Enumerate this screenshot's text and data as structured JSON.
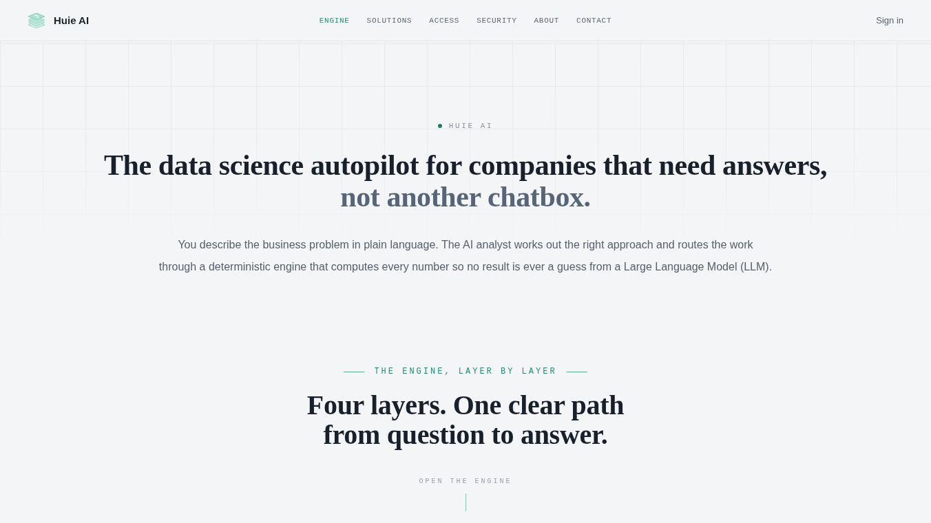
{
  "header": {
    "brand": "Huie AI",
    "nav": [
      {
        "label": "ENGINE",
        "selected": true
      },
      {
        "label": "SOLUTIONS",
        "selected": false
      },
      {
        "label": "ACCESS",
        "selected": false
      },
      {
        "label": "SECURITY",
        "selected": false
      },
      {
        "label": "ABOUT",
        "selected": false
      },
      {
        "label": "CONTACT",
        "selected": false
      }
    ],
    "sign_in": "Sign in"
  },
  "hero": {
    "eyebrow": "HUIE AI",
    "title": "The data science autopilot for companies that need answers,",
    "title_muted": "not another chatbox.",
    "lead": "You describe the business problem in plain language. The AI analyst works out the right approach and routes the work through a deterministic engine that computes every number so no result is ever a guess from a Large Language Model (LLM)."
  },
  "engine_section": {
    "eyebrow": "THE ENGINE, LAYER BY LAYER",
    "title": "Four layers. One clear path from question to answer.",
    "cue": "OPEN THE ENGINE"
  }
}
